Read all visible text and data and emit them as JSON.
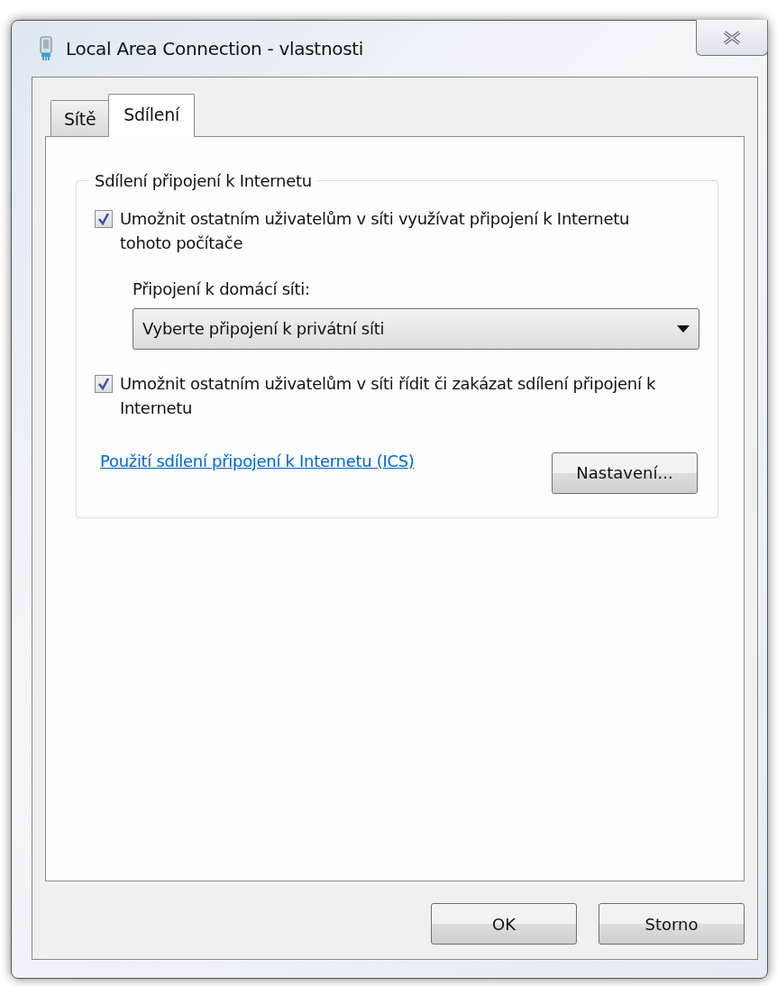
{
  "window": {
    "title": "Local Area Connection - vlastnosti"
  },
  "tabs": [
    {
      "label": "Sítě",
      "selected": false
    },
    {
      "label": "Sdílení",
      "selected": true
    }
  ],
  "group": {
    "title": "Sdílení připojení k Internetu",
    "options": [
      {
        "label": "Umožnit ostatním uživatelům v síti využívat připojení k Internetu tohoto počítače",
        "checked": true
      },
      {
        "label": "Umožnit ostatním uživatelům v síti řídit či zakázat sdílení připojení k Internetu",
        "checked": true
      }
    ],
    "home_connection": {
      "label": "Připojení k domácí síti:",
      "value": "Vyberte připojení k privátní síti"
    },
    "link": "Použití sdílení připojení k Internetu (ICS)",
    "settings_button": "Nastavení..."
  },
  "buttons": [
    "OK",
    "Storno"
  ]
}
